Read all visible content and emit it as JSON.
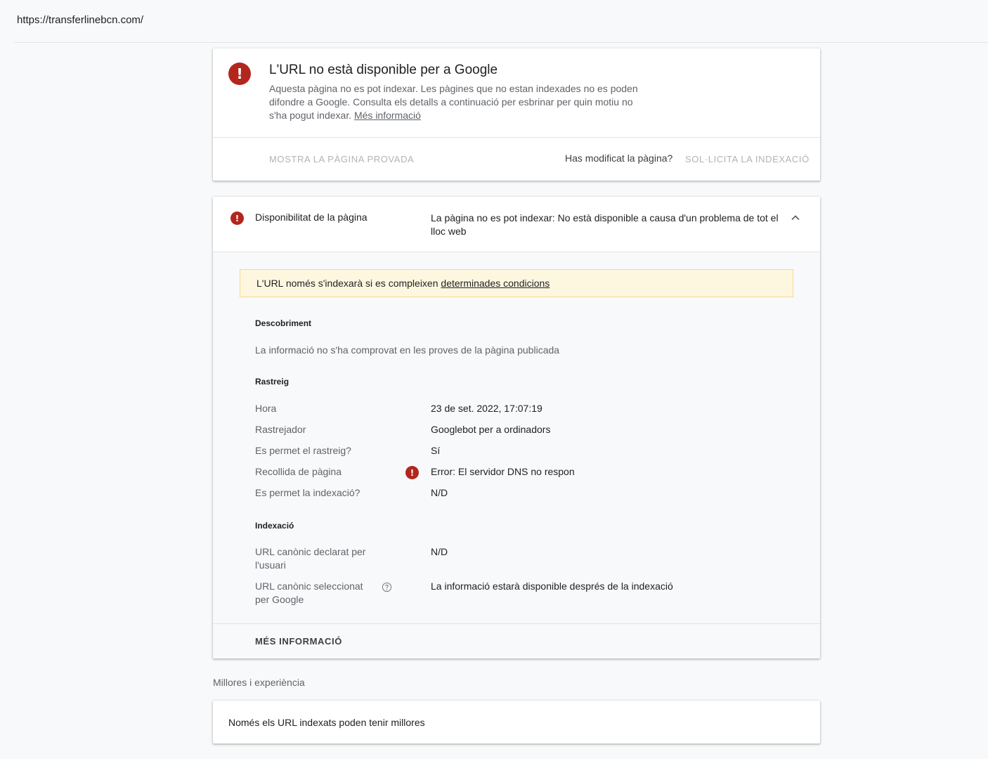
{
  "address": {
    "url": "https://transferlinebcn.com/"
  },
  "status_card": {
    "icon": "error-icon",
    "title": "L'URL no està disponible per a Google",
    "description": "Aquesta pàgina no es pot indexar. Les pàgines que no estan indexades no es poden difondre a Google. Consulta els detalls a continuació per esbrinar per quin motiu no s'ha pogut indexar.",
    "learn_more": "Més informació",
    "show_tested_page": "MOSTRA LA PÀGINA PROVADA",
    "modified_question": "Has modificat la pàgina?",
    "request_indexing": "SOL·LICITA LA INDEXACIÓ"
  },
  "availability_card": {
    "label": "Disponibilitat de la pàgina",
    "value": "La pàgina no es pot indexar: No està disponible a causa d'un problema de tot el lloc web",
    "notice_text": "L'URL només s'indexarà si es compleixen",
    "notice_link": "determinades condicions",
    "discovery": {
      "title": "Descobriment",
      "info": "La informació no s'ha comprovat en les proves de la pàgina publicada"
    },
    "crawl": {
      "title": "Rastreig",
      "rows": [
        {
          "label": "Hora",
          "value": "23 de set. 2022, 17:07:19"
        },
        {
          "label": "Rastrejador",
          "value": "Googlebot per a ordinadors"
        },
        {
          "label": "Es permet el rastreig?",
          "value": "Sí"
        },
        {
          "label": "Recollida de pàgina",
          "value": "Error: El servidor DNS no respon"
        },
        {
          "label": "Es permet la indexació?",
          "value": "N/D"
        }
      ]
    },
    "indexing": {
      "title": "Indexació",
      "rows": [
        {
          "label": "URL canònic declarat per l'usuari",
          "value": "N/D"
        },
        {
          "label": "URL canònic seleccionat per Google",
          "value": "La informació estarà disponible després de la indexació"
        }
      ]
    },
    "more_info": "MÉS INFORMACIÓ"
  },
  "enhancements": {
    "heading": "Millores i experiència",
    "text": "Només els URL indexats poden tenir millores"
  },
  "colors": {
    "error": "#b3261e",
    "notice_bg": "#fef7e0",
    "notice_border": "#f6d88f"
  }
}
